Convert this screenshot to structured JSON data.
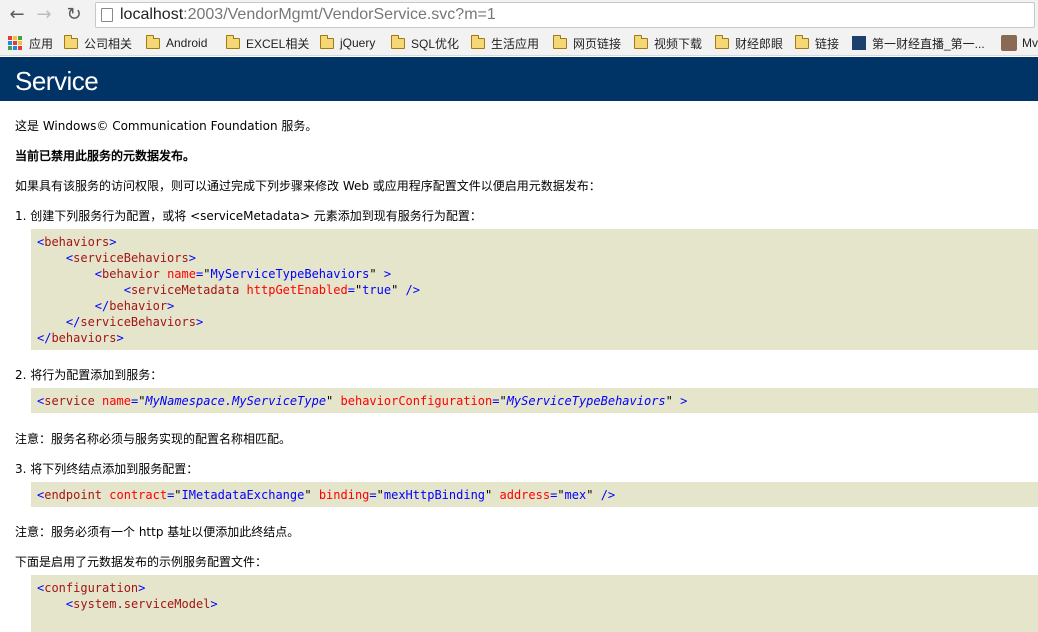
{
  "browser": {
    "url_host": "localhost",
    "url_rest": ":2003/VendorMgmt/VendorService.svc?m=1",
    "bookmarks": [
      "应用",
      "公司相关",
      "Android",
      "EXCEL相关",
      "jQuery",
      "SQL优化",
      "生活应用",
      "网页链接",
      "视频下载",
      "财经郎眼",
      "链接",
      "第一财经直播_第一...",
      "Mv"
    ]
  },
  "page": {
    "title": "Service",
    "intro": "这是 Windows© Communication Foundation 服务。",
    "disabled_notice": "当前已禁用此服务的元数据发布。",
    "access_text": "如果具有该服务的访问权限，则可以通过完成下列步骤来修改 Web 或应用程序配置文件以便启用元数据发布：",
    "step1": "1. 创建下列服务行为配置，或将 <serviceMetadata> 元素添加到现有服务行为配置：",
    "step2": "2. 将行为配置添加到服务：",
    "note1": "注意：服务名称必须与服务实现的配置名称相匹配。",
    "step3": "3. 将下列终结点添加到服务配置：",
    "note2": "注意：服务必须有一个 http 基址以便添加此终结点。",
    "sample_intro": "下面是启用了元数据发布的示例服务配置文件："
  },
  "code": {
    "behaviors": "behaviors",
    "serviceBehaviors": "serviceBehaviors",
    "behavior": "behavior",
    "name_attr": "name",
    "behavior_name": "MyServiceTypeBehaviors",
    "serviceMetadata": "serviceMetadata",
    "httpGetEnabled_attr": "httpGetEnabled",
    "true_val": "true",
    "service": "service",
    "service_name": "MyNamespace.MyServiceType",
    "behaviorConfiguration_attr": "behaviorConfiguration",
    "endpoint": "endpoint",
    "contract_attr": "contract",
    "contract_val": "IMetadataExchange",
    "binding_attr": "binding",
    "binding_val": "mexHttpBinding",
    "address_attr": "address",
    "address_val": "mex",
    "configuration": "configuration",
    "systemServiceModel": "system.serviceModel"
  },
  "colors": {
    "header_bg": "#003366",
    "code_bg": "#e5e5cc",
    "tag": "#0000ff",
    "element": "#a31515",
    "attribute": "#ff0000"
  }
}
